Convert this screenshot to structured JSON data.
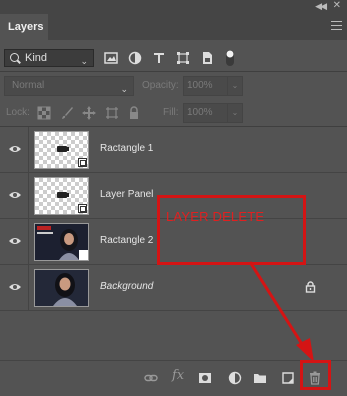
{
  "window": {
    "collapse_icon": "double-chevron",
    "close_icon": "close-x"
  },
  "panel": {
    "tab_label": "Layers",
    "menu_icon": "menu-lines"
  },
  "filter": {
    "kind_label": "Kind",
    "icons": [
      "image-filter-icon",
      "adjustment-filter-icon",
      "type-filter-icon",
      "shape-filter-icon",
      "smart-object-filter-icon",
      "filter-toggle-icon"
    ]
  },
  "blend": {
    "mode": "Normal",
    "opacity_label": "Opacity:",
    "opacity_value": "100%"
  },
  "lock": {
    "label": "Lock:",
    "fill_label": "Fill:",
    "fill_value": "100%"
  },
  "layers": [
    {
      "name": "Ractangle 1",
      "thumb": "transparent-smart",
      "visible": true
    },
    {
      "name": "Layer Panel",
      "thumb": "transparent-smart",
      "visible": true
    },
    {
      "name": "Ractangle 2",
      "thumb": "photo-smart",
      "visible": true
    },
    {
      "name": "Background",
      "thumb": "photo",
      "visible": true,
      "locked": true,
      "italic": true
    }
  ],
  "annotation": {
    "text": "LAYER DELETE",
    "color": "#d41414"
  },
  "footer_icons": [
    "link-icon",
    "fx-icon",
    "mask-icon",
    "adjustment-icon",
    "folder-icon",
    "new-layer-icon",
    "trash-icon"
  ]
}
